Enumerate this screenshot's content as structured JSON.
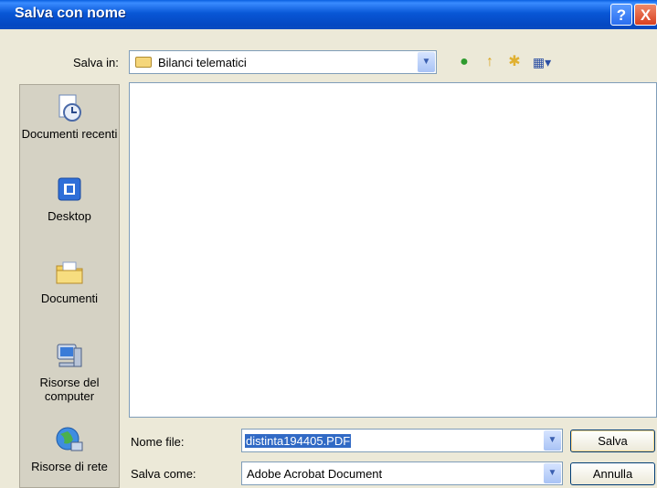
{
  "window": {
    "title": "Salva con nome",
    "help_glyph": "?",
    "close_glyph": "X"
  },
  "toolbar": {
    "save_in_label": "Salva in:",
    "save_in_value": "Bilanci telematici",
    "combo_arrow": "▼",
    "back_glyph": "●",
    "up_glyph": "↑",
    "new_folder_glyph": "✱",
    "view_glyph": "▦▾"
  },
  "places": {
    "items": [
      {
        "label": "Documenti recenti",
        "icon": "recent-documents-icon"
      },
      {
        "label": "Desktop",
        "icon": "desktop-icon"
      },
      {
        "label": "Documenti",
        "icon": "documents-folder-icon"
      },
      {
        "label": "Risorse del computer",
        "icon": "my-computer-icon"
      },
      {
        "label": "Risorse di rete",
        "icon": "network-places-icon"
      }
    ]
  },
  "form": {
    "file_name_label": "Nome file:",
    "file_name_value": "distinta194405.PDF",
    "save_as_label": "Salva come:",
    "save_as_value": "Adobe Acrobat Document"
  },
  "buttons": {
    "save": "Salva",
    "cancel": "Annulla"
  },
  "colors": {
    "title_bar": "#0548c2",
    "dialog_bg": "#ece9d8",
    "selection": "#316ac5"
  }
}
